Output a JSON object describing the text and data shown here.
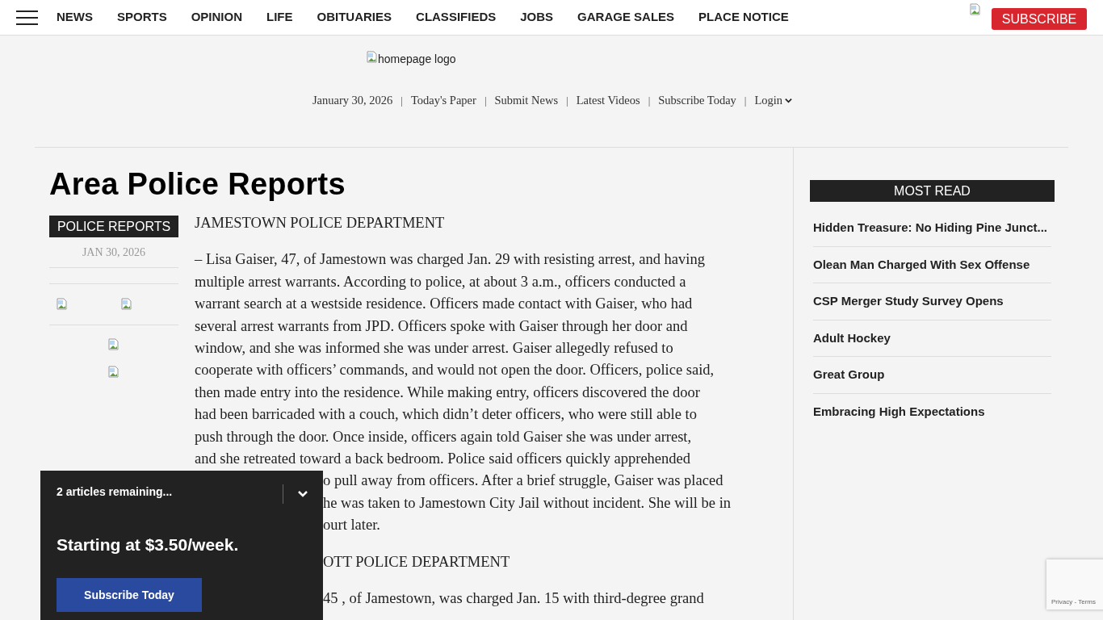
{
  "nav": {
    "items": [
      "NEWS",
      "SPORTS",
      "OPINION",
      "LIFE",
      "OBITUARIES",
      "CLASSIFIEDS",
      "JOBS",
      "GARAGE SALES",
      "PLACE NOTICE"
    ],
    "subscribe": "SUBSCRIBE"
  },
  "header": {
    "logo_alt": "homepage logo",
    "links": [
      "January 30, 2026",
      "Today's Paper",
      "Submit News",
      "Latest Videos",
      "Subscribe Today",
      "Login"
    ],
    "separator": "|"
  },
  "article": {
    "title": "Area Police Reports",
    "category": "POLICE REPORTS",
    "date": "JAN 30, 2026",
    "blocks": [
      {
        "kind": "heading",
        "text": "JAMESTOWN POLICE DEPARTMENT"
      },
      {
        "kind": "paragraph",
        "lines": [
          "– Lisa Gaiser, 47, of Jamestown was charged Jan. 29 with resisting arrest, and having",
          "multiple arrest warrants. According to police, at about 3 a.m., officers conducted a",
          "warrant search at a westside residence. Officers made contact with Gaiser, who had",
          "several arrest warrants from JPD. Officers spoke with Gaiser through her door and",
          "window, and she was informed she was under arrest. Gaiser allegedly refused to",
          "cooperate with officers’ commands, and would not open the door. Officers, police said,",
          "then made entry into the residence. While making entry, officers discovered the door",
          "had been barricaded with a couch, which didn’t deter officers, who were still able to",
          "push through the door. Once inside, officers again told Gaiser she was under arrest,",
          "and she retreated toward a back bedroom. Police said officers quickly apprehended"
        ],
        "fragments": [
          "o pull away from officers. After a brief struggle, Gaiser was placed",
          "he was taken to Jamestown City Jail without incident. She will be in",
          "ourt later."
        ]
      },
      {
        "kind": "heading_fragment",
        "text": "OTT POLICE DEPARTMENT"
      },
      {
        "kind": "paragraph_fragment",
        "text": "45 , of Jamestown, was charged Jan. 15 with third-degree grand"
      }
    ]
  },
  "most_read": {
    "title": "MOST READ",
    "items": [
      "Hidden Treasure: No Hiding Pine Junct...",
      "Olean Man Charged With Sex Offense",
      "CSP Merger Study Survey Opens",
      "Adult Hockey",
      "Great Group",
      "Embracing High Expectations"
    ]
  },
  "paywall": {
    "remaining": "2 articles remaining...",
    "price": "Starting at $3.50/week.",
    "button": "Subscribe Today"
  },
  "recaptcha": {
    "links": "Privacy - Terms"
  }
}
